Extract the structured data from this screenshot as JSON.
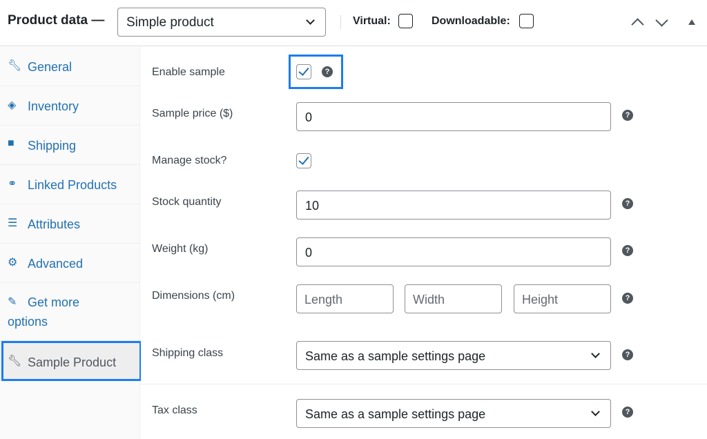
{
  "header": {
    "title": "Product data —",
    "product_type": "Simple product",
    "virtual_label": "Virtual:",
    "downloadable_label": "Downloadable:"
  },
  "sidebar": {
    "items": [
      {
        "label": "General",
        "icon": "wrench-icon"
      },
      {
        "label": "Inventory",
        "icon": "tag-icon"
      },
      {
        "label": "Shipping",
        "icon": "truck-icon"
      },
      {
        "label": "Linked Products",
        "icon": "link-icon"
      },
      {
        "label": "Attributes",
        "icon": "list-icon"
      },
      {
        "label": "Advanced",
        "icon": "gear-icon"
      },
      {
        "label": "Get more options",
        "icon": "plug-icon"
      },
      {
        "label": "Sample Product",
        "icon": "wrench-icon",
        "active": true
      }
    ]
  },
  "form": {
    "enable_sample": {
      "label": "Enable sample",
      "checked": true
    },
    "sample_price": {
      "label": "Sample price ($)",
      "value": "0"
    },
    "manage_stock": {
      "label": "Manage stock?",
      "checked": true
    },
    "stock_quantity": {
      "label": "Stock quantity",
      "value": "10"
    },
    "weight": {
      "label": "Weight (kg)",
      "value": "0"
    },
    "dimensions": {
      "label": "Dimensions (cm)",
      "length_placeholder": "Length",
      "width_placeholder": "Width",
      "height_placeholder": "Height"
    },
    "shipping_class": {
      "label": "Shipping class",
      "value": "Same as a sample settings page"
    },
    "tax_class": {
      "label": "Tax class",
      "value": "Same as a sample settings page"
    },
    "help_glyph": "?"
  },
  "colors": {
    "link": "#2271b1",
    "highlight": "#1b7cf5"
  }
}
